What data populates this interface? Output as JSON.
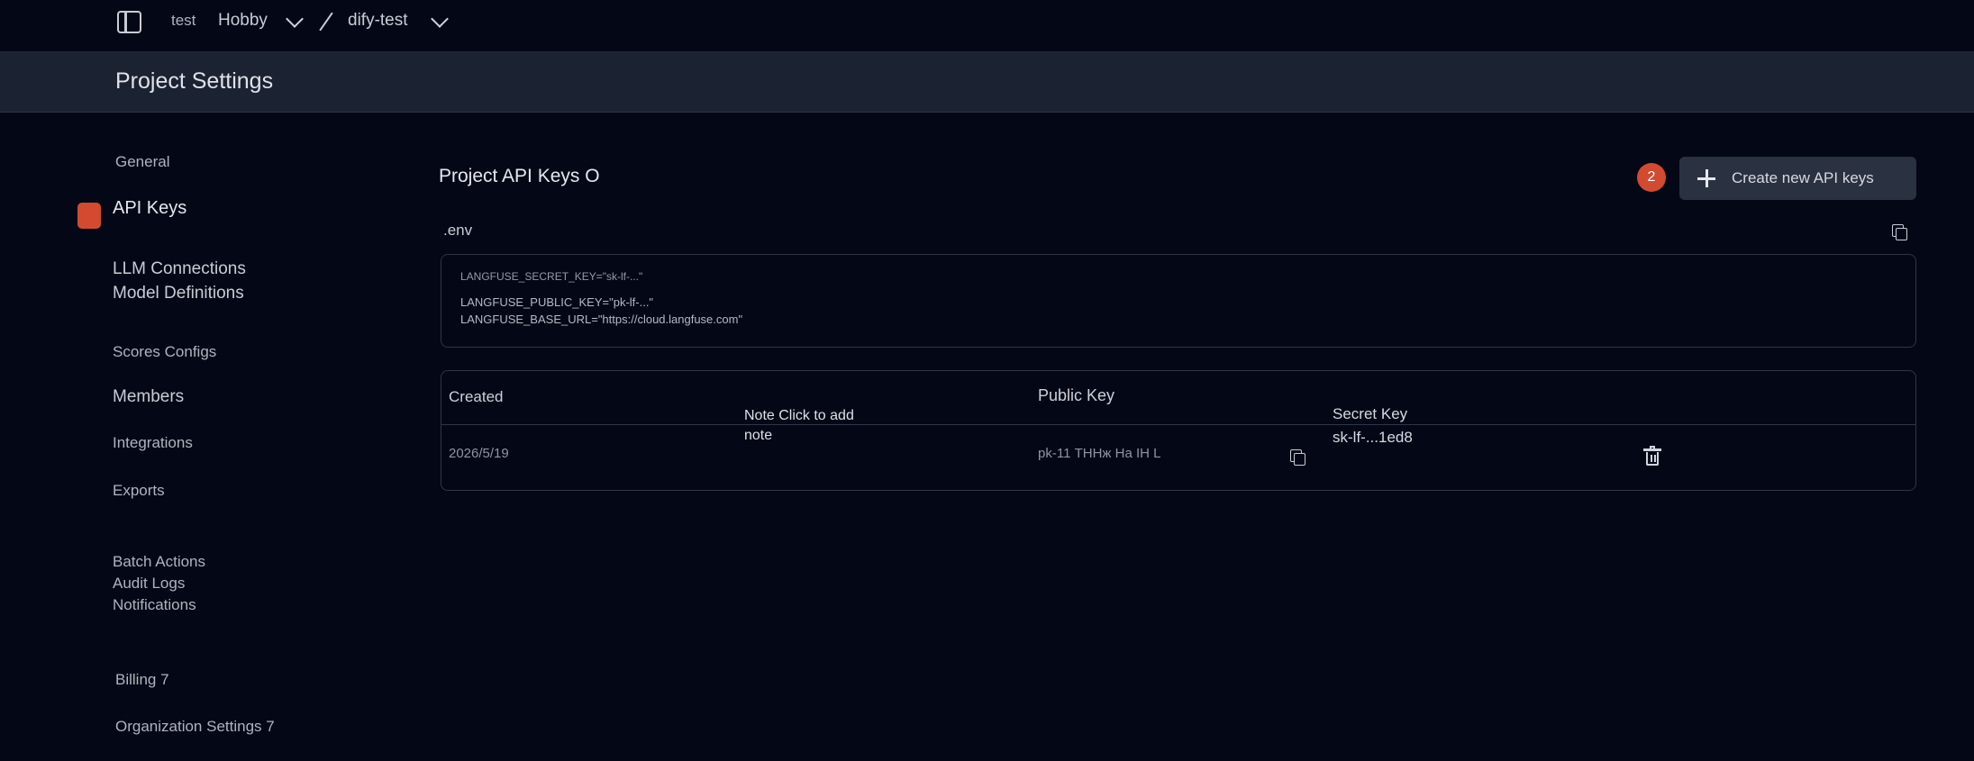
{
  "topbar": {
    "org": "test",
    "plan": "Hobby",
    "project": "dify-test"
  },
  "header": {
    "title": "Project Settings"
  },
  "sidebar": {
    "items": [
      {
        "label": "General"
      },
      {
        "label": "API Keys",
        "active": true
      },
      {
        "label": "LLM Connections"
      },
      {
        "label": "Model Definitions"
      },
      {
        "label": "Scores Configs"
      },
      {
        "label": "Members"
      },
      {
        "label": "Integrations"
      },
      {
        "label": "Exports"
      },
      {
        "label": "Batch Actions"
      },
      {
        "label": "Audit Logs"
      },
      {
        "label": "Notifications"
      },
      {
        "label": "Billing 7"
      },
      {
        "label": "Organization Settings 7"
      }
    ]
  },
  "main": {
    "section_title": "Project API Keys O",
    "badge_count": "2",
    "create_button": "Create new API keys",
    "env_label": ".env",
    "env_lines": [
      "LANGFUSE_SECRET_KEY=\"sk-lf-...\"",
      "LANGFUSE_PUBLIC_KEY=\"pk-lf-...\"",
      "LANGFUSE_BASE_URL=\"https://cloud.langfuse.com\""
    ],
    "table": {
      "headers": {
        "created": "Created",
        "note": "Note Click to add note",
        "public_key": "Public Key",
        "secret_key": "Secret Key"
      },
      "rows": [
        {
          "created": "2026/5/19",
          "public_key": "pk-11 ТННж На IH L",
          "secret_key": "sk-lf-...1ed8"
        }
      ]
    }
  },
  "colors": {
    "background": "#040816",
    "header": "#1b2231",
    "accent": "#d24a2f",
    "button": "#2a3140"
  },
  "icons": [
    "sidebar-toggle-icon",
    "chevron-down-icon",
    "plus-icon",
    "copy-icon",
    "trash-icon"
  ]
}
